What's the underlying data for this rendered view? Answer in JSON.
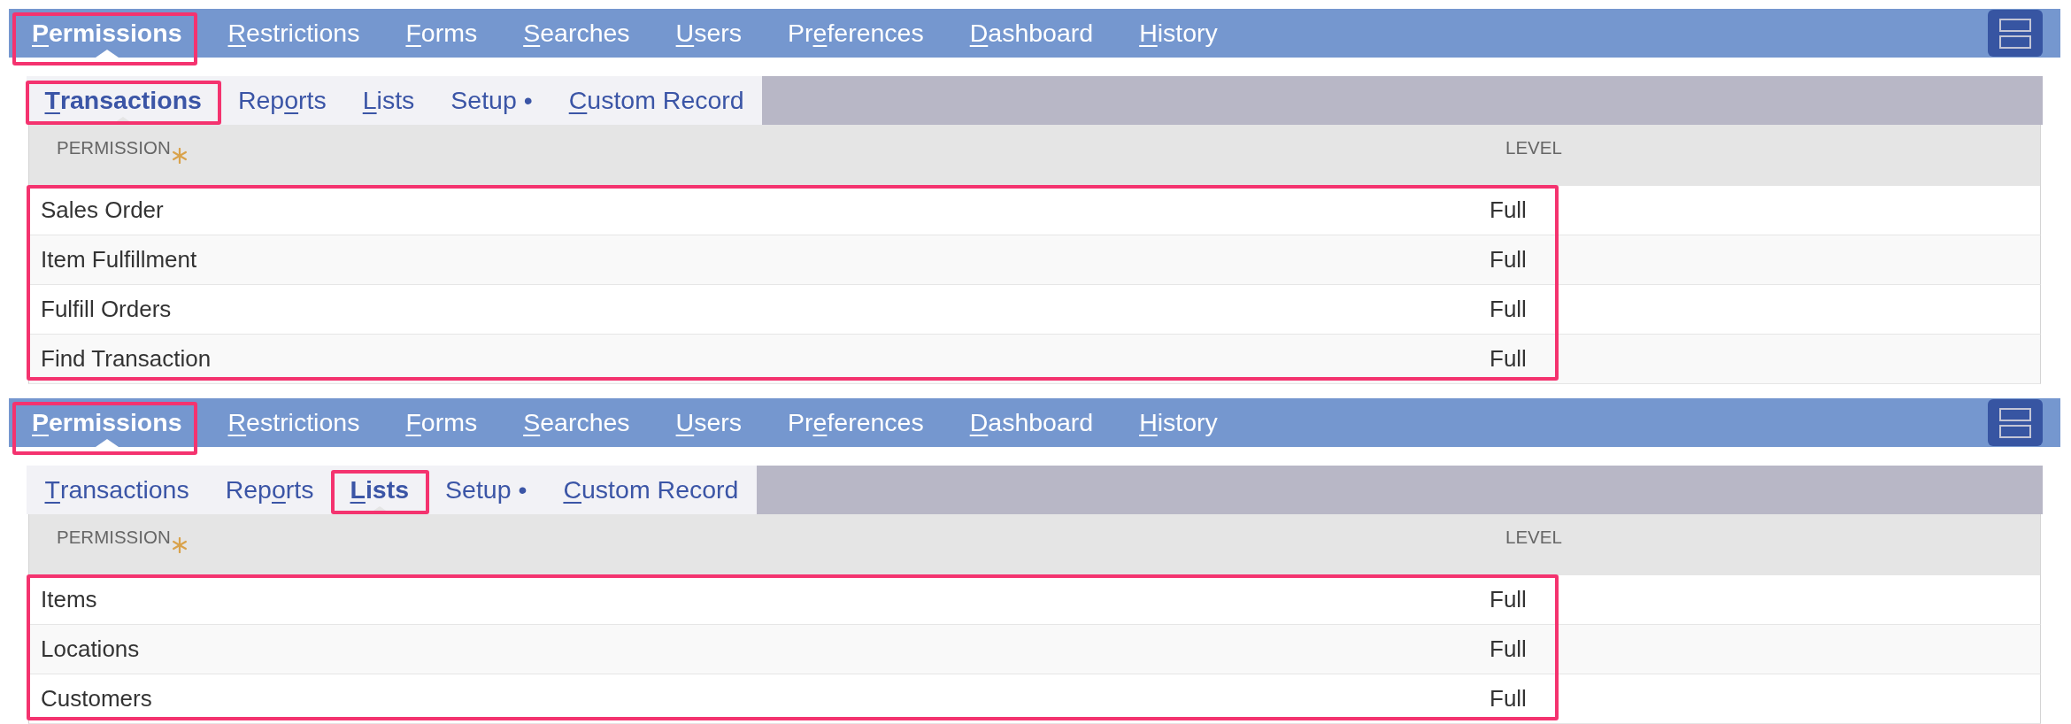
{
  "panels": [
    {
      "main_tabs": [
        {
          "parts": [
            {
              "kind": "key",
              "text": "P"
            },
            {
              "kind": "plain",
              "text": "ermissions"
            }
          ],
          "selected": true,
          "highlighted": true
        },
        {
          "parts": [
            {
              "kind": "key",
              "text": "R"
            },
            {
              "kind": "plain",
              "text": "estrictions"
            }
          ],
          "selected": false,
          "highlighted": false
        },
        {
          "parts": [
            {
              "kind": "key",
              "text": "F"
            },
            {
              "kind": "plain",
              "text": "orms"
            }
          ],
          "selected": false,
          "highlighted": false
        },
        {
          "parts": [
            {
              "kind": "key",
              "text": "S"
            },
            {
              "kind": "plain",
              "text": "earches"
            }
          ],
          "selected": false,
          "highlighted": false
        },
        {
          "parts": [
            {
              "kind": "key",
              "text": "U"
            },
            {
              "kind": "plain",
              "text": "sers"
            }
          ],
          "selected": false,
          "highlighted": false
        },
        {
          "parts": [
            {
              "kind": "plain",
              "text": "Pr"
            },
            {
              "kind": "key",
              "text": "e"
            },
            {
              "kind": "plain",
              "text": "ferences"
            }
          ],
          "selected": false,
          "highlighted": false
        },
        {
          "parts": [
            {
              "kind": "key",
              "text": "D"
            },
            {
              "kind": "plain",
              "text": "ashboard"
            }
          ],
          "selected": false,
          "highlighted": false
        },
        {
          "parts": [
            {
              "kind": "key",
              "text": "H"
            },
            {
              "kind": "plain",
              "text": "istory"
            }
          ],
          "selected": false,
          "highlighted": false
        }
      ],
      "sub_tabs": [
        {
          "parts": [
            {
              "kind": "key",
              "text": "T"
            },
            {
              "kind": "plain",
              "text": "ransactions"
            }
          ],
          "selected": true,
          "highlighted": true
        },
        {
          "parts": [
            {
              "kind": "plain",
              "text": "Rep"
            },
            {
              "kind": "key",
              "text": "o"
            },
            {
              "kind": "plain",
              "text": "rts"
            }
          ],
          "selected": false,
          "highlighted": false
        },
        {
          "parts": [
            {
              "kind": "key",
              "text": "L"
            },
            {
              "kind": "plain",
              "text": "ists"
            }
          ],
          "selected": false,
          "highlighted": false
        },
        {
          "parts": [
            {
              "kind": "plain",
              "text": "Setup •"
            }
          ],
          "selected": false,
          "highlighted": false
        },
        {
          "parts": [
            {
              "kind": "key",
              "text": "C"
            },
            {
              "kind": "plain",
              "text": "ustom Record"
            }
          ],
          "selected": false,
          "highlighted": false
        }
      ],
      "table": {
        "columns": [
          {
            "label": "PERMISSION",
            "required": true
          },
          {
            "label": "LEVEL",
            "required": false
          }
        ],
        "rows": [
          [
            "Sales Order",
            "Full"
          ],
          [
            "Item Fulfillment",
            "Full"
          ],
          [
            "Fulfill Orders",
            "Full"
          ],
          [
            "Find Transaction",
            "Full"
          ]
        ],
        "highlighted": true
      }
    },
    {
      "main_tabs": [
        {
          "parts": [
            {
              "kind": "key",
              "text": "P"
            },
            {
              "kind": "plain",
              "text": "ermissions"
            }
          ],
          "selected": true,
          "highlighted": true
        },
        {
          "parts": [
            {
              "kind": "key",
              "text": "R"
            },
            {
              "kind": "plain",
              "text": "estrictions"
            }
          ],
          "selected": false,
          "highlighted": false
        },
        {
          "parts": [
            {
              "kind": "key",
              "text": "F"
            },
            {
              "kind": "plain",
              "text": "orms"
            }
          ],
          "selected": false,
          "highlighted": false
        },
        {
          "parts": [
            {
              "kind": "key",
              "text": "S"
            },
            {
              "kind": "plain",
              "text": "earches"
            }
          ],
          "selected": false,
          "highlighted": false
        },
        {
          "parts": [
            {
              "kind": "key",
              "text": "U"
            },
            {
              "kind": "plain",
              "text": "sers"
            }
          ],
          "selected": false,
          "highlighted": false
        },
        {
          "parts": [
            {
              "kind": "plain",
              "text": "Pr"
            },
            {
              "kind": "key",
              "text": "e"
            },
            {
              "kind": "plain",
              "text": "ferences"
            }
          ],
          "selected": false,
          "highlighted": false
        },
        {
          "parts": [
            {
              "kind": "key",
              "text": "D"
            },
            {
              "kind": "plain",
              "text": "ashboard"
            }
          ],
          "selected": false,
          "highlighted": false
        },
        {
          "parts": [
            {
              "kind": "key",
              "text": "H"
            },
            {
              "kind": "plain",
              "text": "istory"
            }
          ],
          "selected": false,
          "highlighted": false
        }
      ],
      "sub_tabs": [
        {
          "parts": [
            {
              "kind": "key",
              "text": "T"
            },
            {
              "kind": "plain",
              "text": "ransactions"
            }
          ],
          "selected": false,
          "highlighted": false
        },
        {
          "parts": [
            {
              "kind": "plain",
              "text": "Rep"
            },
            {
              "kind": "key",
              "text": "o"
            },
            {
              "kind": "plain",
              "text": "rts"
            }
          ],
          "selected": false,
          "highlighted": false
        },
        {
          "parts": [
            {
              "kind": "key",
              "text": "L"
            },
            {
              "kind": "plain",
              "text": "ists"
            }
          ],
          "selected": true,
          "highlighted": true
        },
        {
          "parts": [
            {
              "kind": "plain",
              "text": "Setup •"
            }
          ],
          "selected": false,
          "highlighted": false
        },
        {
          "parts": [
            {
              "kind": "key",
              "text": "C"
            },
            {
              "kind": "plain",
              "text": "ustom Record"
            }
          ],
          "selected": false,
          "highlighted": false
        }
      ],
      "table": {
        "columns": [
          {
            "label": "PERMISSION",
            "required": true
          },
          {
            "label": "LEVEL",
            "required": false
          }
        ],
        "rows": [
          [
            "Items",
            "Full"
          ],
          [
            "Locations",
            "Full"
          ],
          [
            "Customers",
            "Full"
          ]
        ],
        "highlighted": true
      }
    }
  ]
}
